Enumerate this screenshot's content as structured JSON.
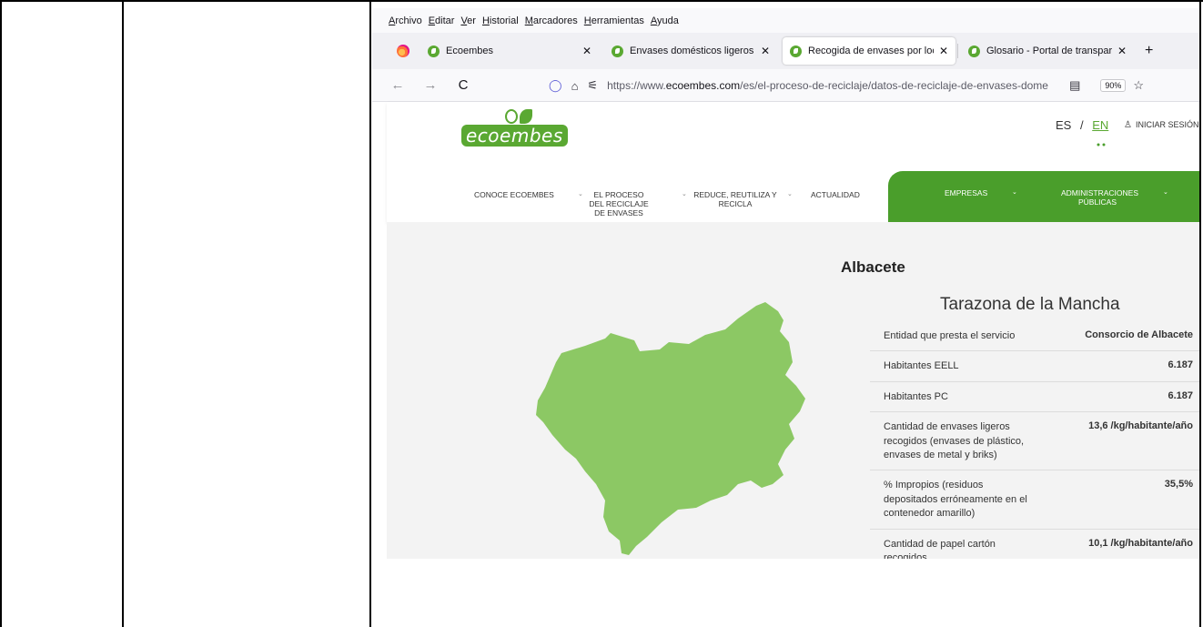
{
  "menubar": [
    "Archivo",
    "Editar",
    "Ver",
    "Historial",
    "Marcadores",
    "Herramientas",
    "Ayuda"
  ],
  "tabs": [
    {
      "title": "Ecoembes",
      "active": false
    },
    {
      "title": "Envases domésticos ligeros - Po",
      "active": false
    },
    {
      "title": "Recogida de envases por localic",
      "active": true
    },
    {
      "title": "Glosario - Portal de transparenc",
      "active": false
    }
  ],
  "nav": {
    "back": "←",
    "forward": "→",
    "reload": "C",
    "url_prefix": "https://www.",
    "url_domain": "ecoembes.com",
    "url_path": "/es/el-proceso-de-reciclaje/datos-de-reciclaje-de-envases-dome",
    "zoom": "90%"
  },
  "site": {
    "logo_text": "ecoembes",
    "lang_es": "ES",
    "lang_sep": "/",
    "lang_en": "EN",
    "login": "INICIAR SESIÓN",
    "menu": [
      "CONOCE ECOEMBES",
      "EL PROCESO DEL RECICLAJE DE ENVASES",
      "REDUCE, REUTILIZA Y RECICLA",
      "ACTUALIDAD"
    ],
    "green_menu": [
      "EMPRESAS",
      "ADMINISTRACIONES PÚBLICAS"
    ],
    "province": "Albacete",
    "municipality": "Tarazona de la Mancha",
    "table": [
      {
        "k": "Entidad que presta el servicio",
        "v": "Consorcio de Albacete"
      },
      {
        "k": "Habitantes EELL",
        "v": "6.187"
      },
      {
        "k": "Habitantes PC",
        "v": "6.187"
      },
      {
        "k": "Cantidad de envases ligeros recogidos (envases de plástico, envases de metal y briks)",
        "v": "13,6 /kg/habitante/año"
      },
      {
        "k": "% Impropios (residuos depositados erróneamente en el contenedor amarillo)",
        "v": "35,5%"
      },
      {
        "k": "Cantidad de papel cartón recogidos",
        "v": "10,1 /kg/habitante/año"
      }
    ],
    "colors": {
      "brand_green": "#5aa832",
      "bar_green": "#4a9e2b",
      "map_green": "#8cc864"
    }
  }
}
